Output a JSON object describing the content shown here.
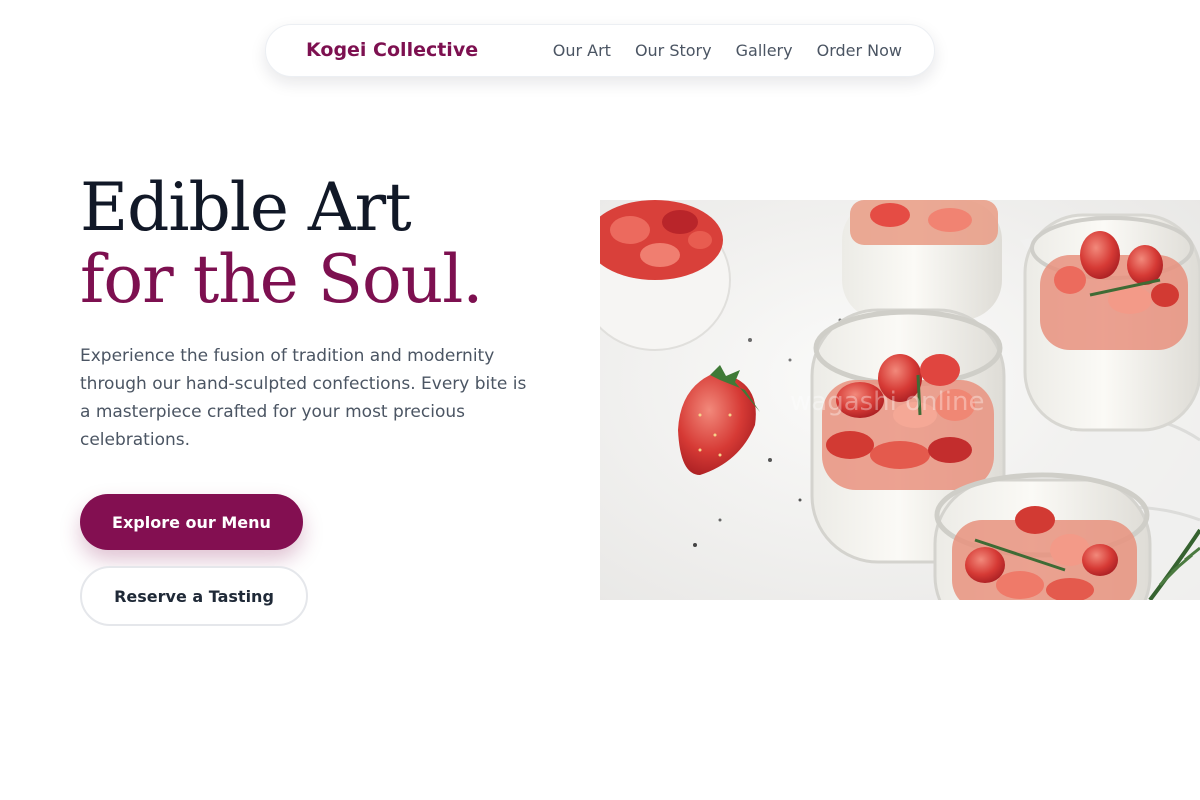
{
  "nav": {
    "brand": "Kogei Collective",
    "links": [
      "Our Art",
      "Our Story",
      "Gallery",
      "Order Now"
    ]
  },
  "hero": {
    "title_line1": "Edible Art",
    "title_line2": "for the Soul.",
    "description": "Experience the fusion of tradition and modernity through our hand-sculpted confections. Every bite is a masterpiece crafted for your most precious celebrations.",
    "primary_button": "Explore our Menu",
    "secondary_button": "Reserve a Tasting",
    "image_watermark": "wagashi online"
  },
  "colors": {
    "accent": "#830f51",
    "heading": "#111827",
    "body_text": "#4b5563"
  }
}
